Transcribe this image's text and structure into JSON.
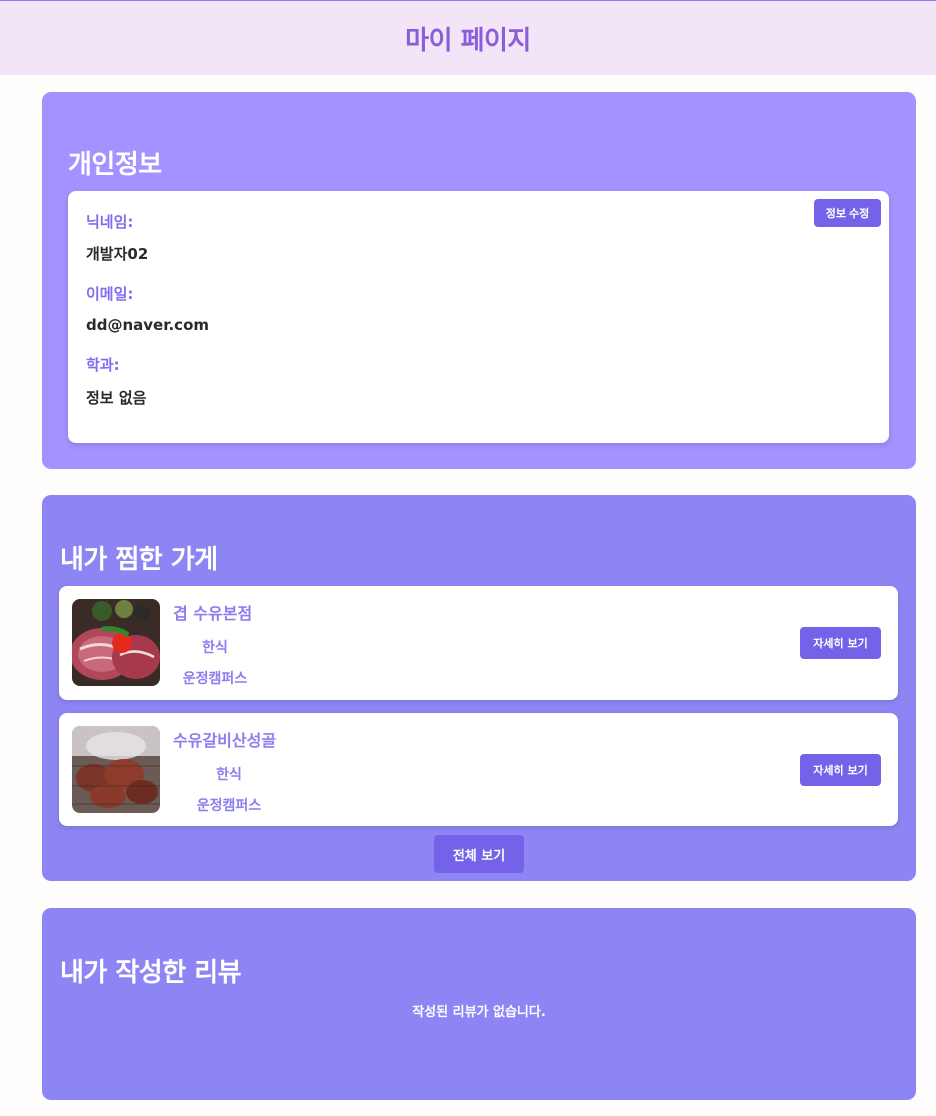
{
  "header": {
    "title": "마이 페이지"
  },
  "profile": {
    "title": "개인정보",
    "edit_label": "정보 수정",
    "fields": [
      {
        "label": "닉네임:",
        "value": "개발자02"
      },
      {
        "label": "이메일:",
        "value": "dd@naver.com"
      },
      {
        "label": "학과:",
        "value": "정보 없음"
      }
    ]
  },
  "favorites": {
    "title": "내가 찜한 가게",
    "detail_label": "자세히 보기",
    "view_all_label": "전체 보기",
    "stores": [
      {
        "name": "겹 수유본점",
        "category": "한식",
        "campus": "운정캠퍼스"
      },
      {
        "name": "수유갈비산성골",
        "category": "한식",
        "campus": "운정캠퍼스"
      }
    ]
  },
  "reviews": {
    "title": "내가 작성한 리뷰",
    "empty_message": "작성된 리뷰가 없습니다."
  },
  "colors": {
    "header_bg": "#f3e5f8",
    "header_text": "#8a5ed8",
    "panel_profile": "#a392ff",
    "panel_secondary": "#8e85f4",
    "button": "#7463e8",
    "accent_text": "#7f6cf0"
  }
}
